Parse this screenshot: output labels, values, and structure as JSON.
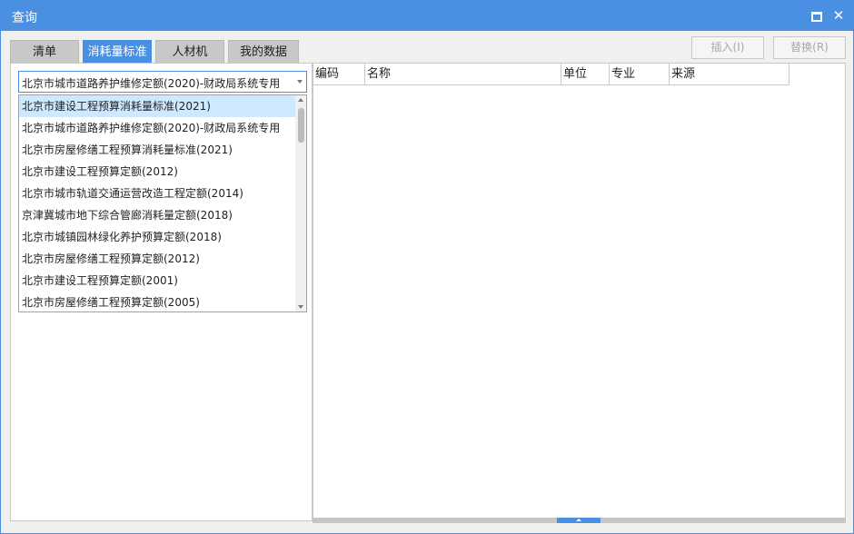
{
  "window": {
    "title": "查询"
  },
  "tabs": [
    {
      "label": "清单"
    },
    {
      "label": "消耗量标准"
    },
    {
      "label": "人材机"
    },
    {
      "label": "我的数据"
    }
  ],
  "actions": {
    "insert_label": "插入(I)",
    "replace_label": "替换(R)"
  },
  "combo": {
    "selected": "北京市城市道路养护维修定额(2020)-财政局系统专用"
  },
  "dropdown": {
    "items": [
      {
        "label": "北京市建设工程预算消耗量标准(2021)"
      },
      {
        "label": "北京市城市道路养护维修定额(2020)-财政局系统专用"
      },
      {
        "label": "北京市房屋修缮工程预算消耗量标准(2021)"
      },
      {
        "label": "北京市建设工程预算定额(2012)"
      },
      {
        "label": "北京市城市轨道交通运营改造工程定额(2014)"
      },
      {
        "label": "京津冀城市地下综合管廊消耗量定额(2018)"
      },
      {
        "label": "北京市城镇园林绿化养护预算定额(2018)"
      },
      {
        "label": "北京市房屋修缮工程预算定额(2012)"
      },
      {
        "label": "北京市建设工程预算定额(2001)"
      },
      {
        "label": "北京市房屋修缮工程预算定额(2005)"
      }
    ]
  },
  "grid": {
    "columns": [
      {
        "label": "编码"
      },
      {
        "label": "名称"
      },
      {
        "label": "单位"
      },
      {
        "label": "专业"
      },
      {
        "label": "来源"
      }
    ]
  },
  "colors": {
    "accent": "#4a90e2",
    "selection": "#cde8ff"
  }
}
